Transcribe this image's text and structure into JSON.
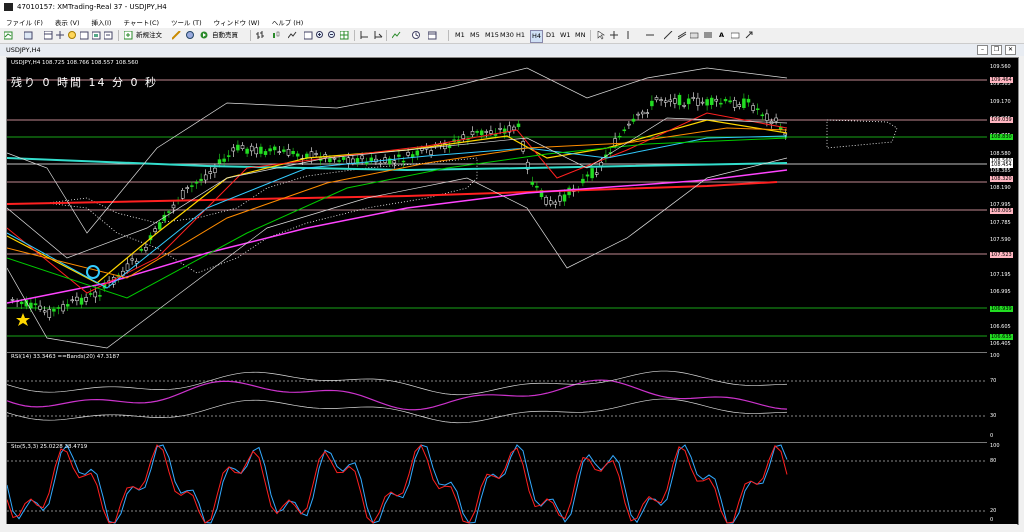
{
  "window": {
    "title": "47010157: XMTrading-Real 37 - USDJPY,H4"
  },
  "menu": [
    "ファイル (F)",
    "表示 (V)",
    "挿入(I)",
    "チャート(C)",
    "ツール (T)",
    "ウィンドウ (W)",
    "ヘルプ (H)"
  ],
  "toolbar": {
    "new_order": "新規注文",
    "auto_trade": "自動売買",
    "timeframes": [
      "M1",
      "M5",
      "M15",
      "M30",
      "H1",
      "H4",
      "D1",
      "W1",
      "MN"
    ],
    "text_tool": "A"
  },
  "tab": {
    "label": "USDJPY,H4"
  },
  "chart": {
    "header": "USDJPY,H4  108.725 108.766 108.557 108.560",
    "countdown": "残り 0 時間 14 分 0 秒",
    "price_ticks": [
      "109.560",
      "109.365",
      "109.170",
      "108.975",
      "108.775",
      "108.580",
      "108.385",
      "108.190",
      "107.995",
      "107.785",
      "107.590",
      "107.395",
      "107.195",
      "106.995",
      "106.800",
      "106.605",
      "106.405"
    ],
    "price_boxes": [
      {
        "label": "109.464",
        "color": "#ffb6c1"
      },
      {
        "label": "109.039",
        "color": "#ffb6c1"
      },
      {
        "label": "108.830",
        "color": "#22dd22"
      },
      {
        "label": "108.560",
        "color": "#ffffff"
      },
      {
        "label": "108.454",
        "color": "#ffffff"
      },
      {
        "label": "108.320",
        "color": "#ffb6c1"
      },
      {
        "label": "108.005",
        "color": "#ffb6c1"
      },
      {
        "label": "107.523",
        "color": "#ffb6c1"
      },
      {
        "label": "106.939",
        "color": "#22dd22"
      },
      {
        "label": "106.635",
        "color": "#22dd22"
      }
    ],
    "rsi_header": "RSI(14) 33.3463  ==Bands(20) 47.3187",
    "rsi_ticks": [
      "100",
      "70",
      "30",
      "0"
    ],
    "stoch_header": "Sto(5,3,3) 25.0228 38.4719",
    "stoch_ticks": [
      "100",
      "80",
      "20",
      "0"
    ],
    "colors": {
      "up": "#22dd22",
      "down": "#ffffff",
      "ma_red": "#ff2020",
      "ma_yellow": "#ffd700",
      "ma_cyan": "#33ccff",
      "ma_magenta": "#ff44ff",
      "ma_orange": "#ff8c00",
      "ma_green": "#00cc00"
    }
  }
}
